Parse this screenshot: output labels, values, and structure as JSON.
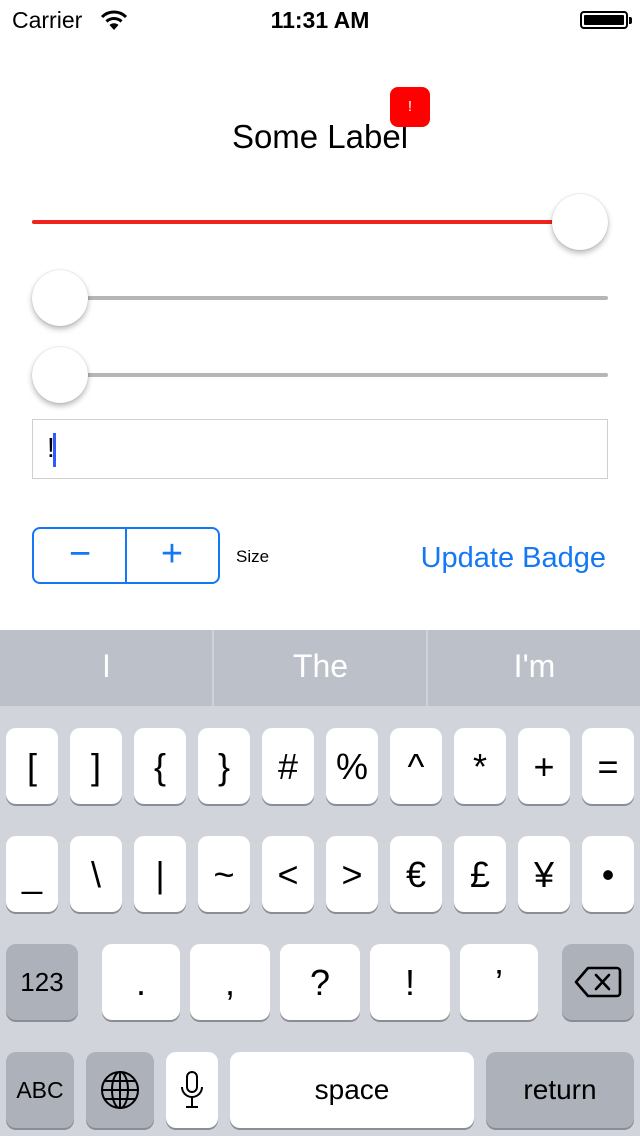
{
  "status_bar": {
    "carrier": "Carrier",
    "time": "11:31 AM"
  },
  "main": {
    "label": "Some Label",
    "badge": "!",
    "sliders": [
      {
        "value": 1.0,
        "track_color": "#f0241c"
      },
      {
        "value": 0.0
      },
      {
        "value": 0.0
      }
    ],
    "text_field_value": "!",
    "stepper": {
      "minus": "−",
      "plus": "+"
    },
    "size_label": "Size",
    "update_button": "Update Badge"
  },
  "keyboard": {
    "predictions": [
      "I",
      "The",
      "I'm"
    ],
    "row1": [
      "[",
      "]",
      "{",
      "}",
      "#",
      "%",
      "^",
      "*",
      "+",
      "="
    ],
    "row2": [
      "_",
      "\\",
      "|",
      "~",
      "<",
      ">",
      "€",
      "£",
      "¥",
      "•"
    ],
    "row3": {
      "mode": "123",
      "keys": [
        ".",
        ",",
        "?",
        "!",
        "’"
      ],
      "delete": "delete-icon"
    },
    "row4": {
      "abc": "ABC",
      "globe": "globe-icon",
      "mic": "microphone-icon",
      "space": "space",
      "return": "return"
    }
  },
  "colors": {
    "accent": "#1478f5",
    "badge": "#ff0000",
    "slider_fill": "#f0241c"
  }
}
